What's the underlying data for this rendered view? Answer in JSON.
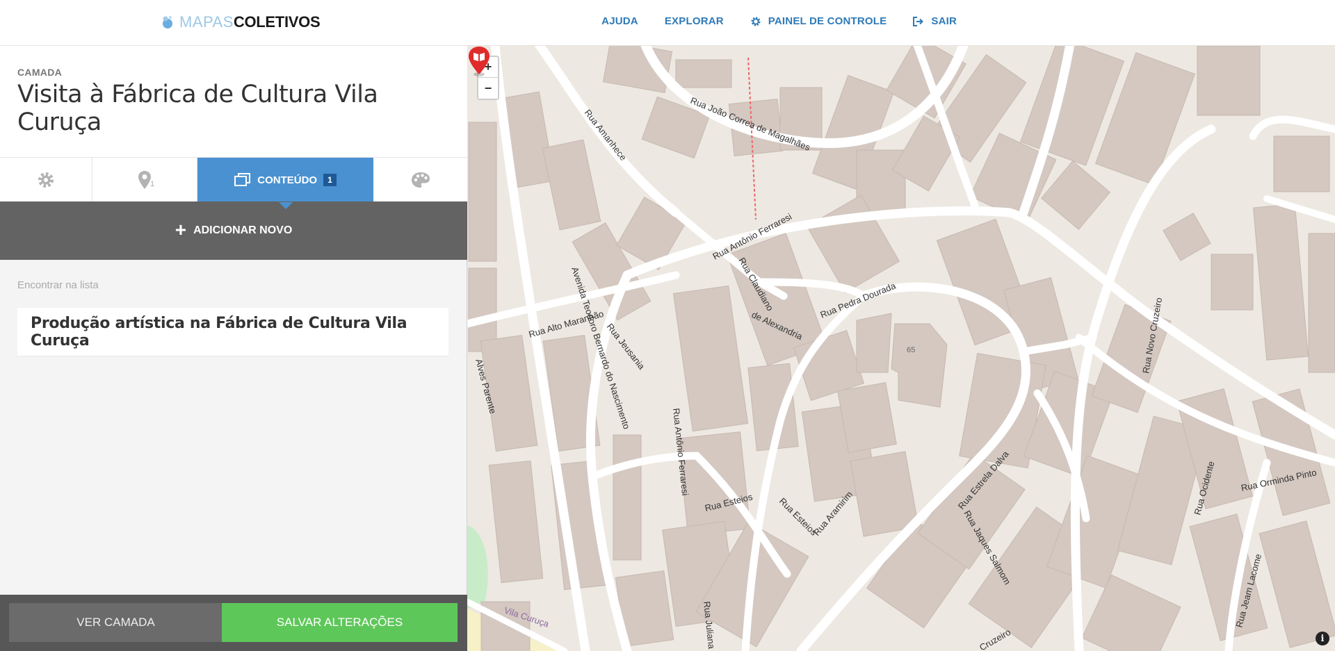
{
  "header": {
    "logo_light": "MAPAS",
    "logo_bold": "COLETIVOS",
    "nav": [
      {
        "label": "AJUDA",
        "icon": "none"
      },
      {
        "label": "EXPLORAR",
        "icon": "none"
      },
      {
        "label": "PAINEL DE CONTROLE",
        "icon": "gear-icon"
      },
      {
        "label": "SAIR",
        "icon": "logout-icon"
      }
    ]
  },
  "sidebar": {
    "layer_label": "CAMADA",
    "layer_title": "Visita à Fábrica de Cultura Vila Curuça",
    "tabs": [
      {
        "icon": "gear-icon"
      },
      {
        "icon": "map-pin-icon",
        "count": "1"
      },
      {
        "icon": "content-icon",
        "label": "CONTEÚDO",
        "count": "1",
        "active": true
      },
      {
        "icon": "palette-icon"
      }
    ],
    "add_label": "ADICIONAR NOVO",
    "search_placeholder": "Encontrar na lista",
    "items": [
      {
        "title": "Produção artística na Fábrica de Cultura Vila Curuça"
      }
    ],
    "footer": {
      "view_label": "VER CAMADA",
      "save_label": "SALVAR ALTERAÇÕES"
    }
  },
  "map": {
    "zoom_in": "+",
    "zoom_out": "−",
    "marker_label": "65",
    "info": "i",
    "streets": [
      "Rua Amanhece",
      "Rua João Correa de Magalhães",
      "Rua Antônio Ferraresi",
      "Rua Claudiano de Alexandria",
      "Rua Pedra Dourada",
      "Rua Alto Maranhão",
      "Avenida Teodoro Bernardo do Nascimento",
      "Rua Jeusania",
      "Rua Antônio Ferraresi",
      "Rua Esteios",
      "Rua Esteios",
      "Rua Aramirim",
      "Rua Estrela Dalva",
      "Rua Jaques Salmom",
      "Rua Novo Cruzeiro",
      "Rua Orminda Pinto",
      "Rua Ocidente",
      "Rua Jeam Lacome",
      "Rua Juliana",
      "Vila Curuça",
      "Alves Parente",
      "Cruzeiro"
    ],
    "colors": {
      "land": "#ede8e1",
      "building": "#d4c8c1",
      "road": "#ffffff",
      "marker": "#e02b2b"
    }
  }
}
